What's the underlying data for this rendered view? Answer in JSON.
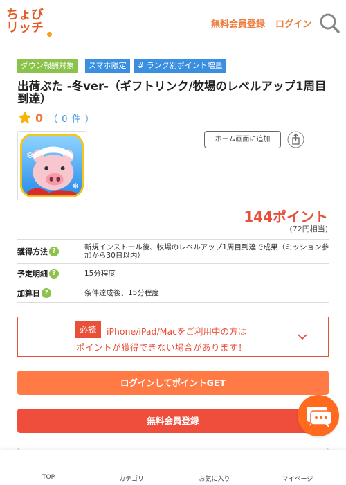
{
  "header": {
    "logo_line1": "ちょび",
    "logo_line2": "リッチ",
    "register_link": "無料会員登録",
    "login_link": "ログイン"
  },
  "tags": [
    "ダウン報酬対象",
    "スマホ限定",
    "# ランク別ポイント増量"
  ],
  "title": "出荷ぶた -冬ver-（ギフトリンク/牧場のレベルアップ1周目到達）",
  "rating": {
    "score": "0",
    "count": "（ 0 件 ）"
  },
  "home_button": "ホーム画面に追加",
  "reward": {
    "points": "144ポイント",
    "yen": "(72円相当)"
  },
  "details": [
    {
      "label": "獲得方法",
      "value": "新規インストール後、牧場のレベルアップ1周目到達で成果（ミッション参加から30日以内）"
    },
    {
      "label": "予定明細",
      "value": "15分程度"
    },
    {
      "label": "加算日",
      "value": "条件達成後、15分程度"
    }
  ],
  "notice": {
    "badge": "必読",
    "line1": "iPhone/iPad/Macをご利用中の方は",
    "line2": "ポイントが獲得できない場合があります！"
  },
  "buttons": {
    "login": "ログインしてポイントGET",
    "register": "無料会員登録"
  },
  "bottom_nav": [
    "TOP",
    "カテゴリ",
    "お気に入り",
    "マイページ"
  ],
  "colors": {
    "accent": "#f07a3a",
    "red": "#e8503a",
    "green": "#8bc34a",
    "blue": "#3a8fe0"
  }
}
